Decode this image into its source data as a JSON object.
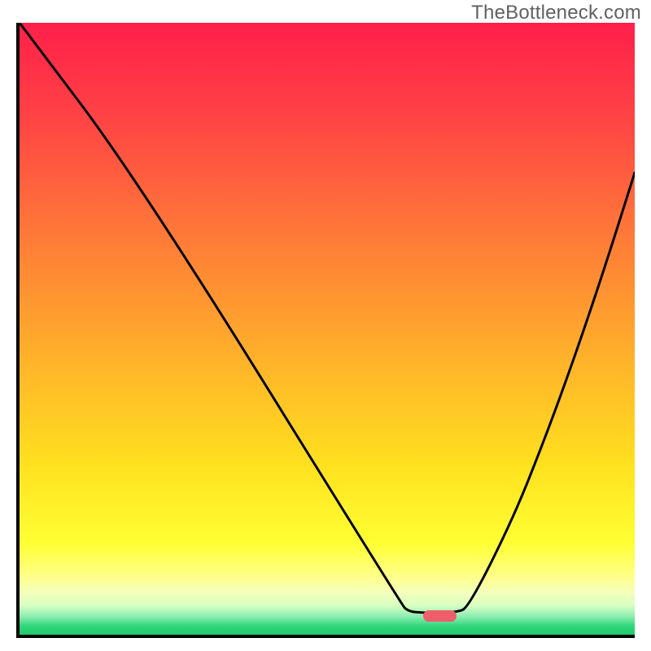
{
  "watermark": "TheBottleneck.com",
  "chart_data": {
    "type": "line",
    "title": "",
    "xlabel": "",
    "ylabel": "",
    "x_range_fraction": [
      0,
      1
    ],
    "y_range_fraction": [
      0,
      1
    ],
    "series": [
      {
        "name": "curve",
        "points_frac": [
          [
            0.0,
            0.0
          ],
          [
            0.195,
            0.26
          ],
          [
            0.622,
            0.952
          ],
          [
            0.63,
            0.96
          ],
          [
            0.645,
            0.964
          ],
          [
            0.71,
            0.964
          ],
          [
            0.73,
            0.955
          ],
          [
            0.8,
            0.815
          ],
          [
            0.85,
            0.69
          ],
          [
            0.9,
            0.553
          ],
          [
            0.95,
            0.404
          ],
          [
            1.0,
            0.245
          ]
        ]
      }
    ],
    "minimum_marker_frac": {
      "x_from": 0.656,
      "x_to": 0.71,
      "y": 0.97
    },
    "gradient_stops": [
      {
        "offset": 0.0,
        "color": "#ff1f4a"
      },
      {
        "offset": 0.15,
        "color": "#ff4245"
      },
      {
        "offset": 0.35,
        "color": "#ff7a38"
      },
      {
        "offset": 0.55,
        "color": "#ffb22a"
      },
      {
        "offset": 0.72,
        "color": "#ffe01f"
      },
      {
        "offset": 0.85,
        "color": "#ffff33"
      },
      {
        "offset": 0.905,
        "color": "#ffff8a"
      },
      {
        "offset": 0.93,
        "color": "#f5ffba"
      },
      {
        "offset": 0.952,
        "color": "#d9ffc2"
      },
      {
        "offset": 0.97,
        "color": "#8eedb2"
      },
      {
        "offset": 0.985,
        "color": "#34d87d"
      },
      {
        "offset": 1.0,
        "color": "#1fc96b"
      }
    ]
  }
}
